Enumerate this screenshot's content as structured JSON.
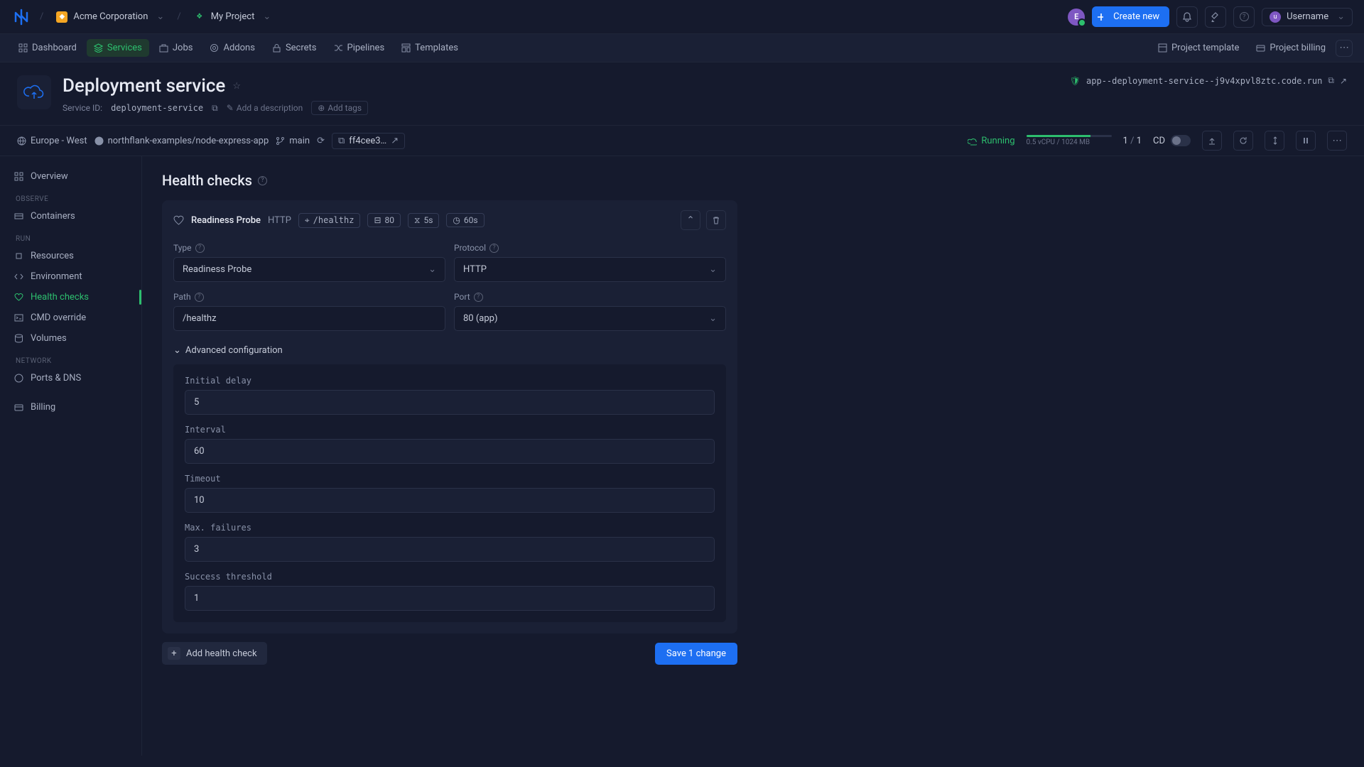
{
  "topbar": {
    "org": "Acme Corporation",
    "project": "My Project",
    "create": "Create new",
    "user": "Username",
    "avatar_letter": "E",
    "user_letter": "u"
  },
  "tabs": {
    "items": [
      "Dashboard",
      "Services",
      "Jobs",
      "Addons",
      "Secrets",
      "Pipelines",
      "Templates"
    ],
    "right": [
      "Project template",
      "Project billing"
    ]
  },
  "service": {
    "title": "Deployment service",
    "id_label": "Service ID:",
    "id": "deployment-service",
    "add_desc": "Add a description",
    "add_tags": "Add tags",
    "domain": "app--deployment-service--j9v4xpvl8ztc.code.run"
  },
  "status": {
    "region": "Europe - West",
    "repo": "northflank-examples/node-express-app",
    "branch": "main",
    "commit": "ff4cee3…",
    "state": "Running",
    "resources": "0.5 vCPU / 1024 MB",
    "instances_a": "1",
    "instances_sep": "/",
    "instances_b": "1",
    "cd": "CD"
  },
  "sidebar": {
    "overview": "Overview",
    "groups": {
      "observe": "OBSERVE",
      "run": "RUN",
      "network": "NETWORK"
    },
    "items": {
      "containers": "Containers",
      "resources": "Resources",
      "environment": "Environment",
      "health": "Health checks",
      "cmd": "CMD override",
      "volumes": "Volumes",
      "ports": "Ports & DNS",
      "billing": "Billing"
    }
  },
  "page": {
    "title": "Health checks",
    "probe": {
      "name": "Readiness Probe",
      "proto_short": "HTTP",
      "pills": {
        "path": "/healthz",
        "port": "80",
        "delay": "5s",
        "interval": "60s"
      }
    },
    "form": {
      "type_label": "Type",
      "type_value": "Readiness Probe",
      "protocol_label": "Protocol",
      "protocol_value": "HTTP",
      "path_label": "Path",
      "path_value": "/healthz",
      "port_label": "Port",
      "port_value": "80 (app)",
      "adv_label": "Advanced configuration",
      "fields": {
        "initial_delay": {
          "label": "Initial delay",
          "value": "5"
        },
        "interval": {
          "label": "Interval",
          "value": "60"
        },
        "timeout": {
          "label": "Timeout",
          "value": "10"
        },
        "max_failures": {
          "label": "Max. failures",
          "value": "3"
        },
        "success_threshold": {
          "label": "Success threshold",
          "value": "1"
        }
      }
    },
    "add_button": "Add health check",
    "save_button": "Save 1 change"
  }
}
